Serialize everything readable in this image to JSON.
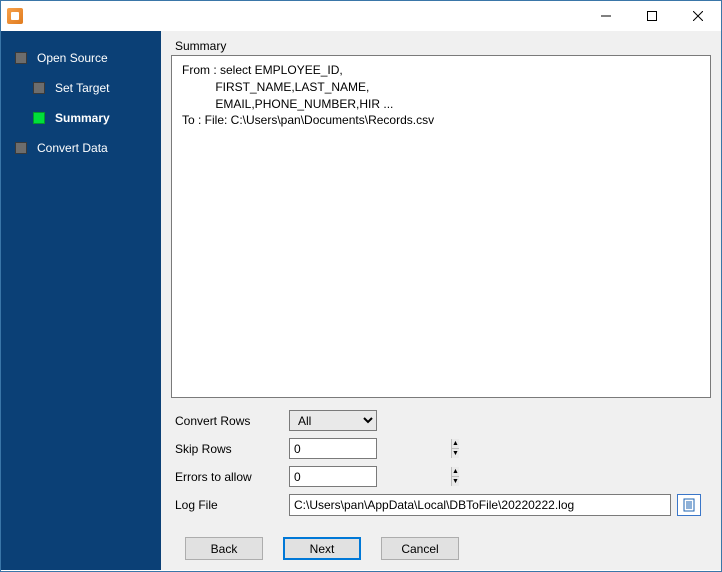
{
  "titlebar": {
    "title": ""
  },
  "sidebar": {
    "steps": [
      {
        "label": "Open Source",
        "active": false,
        "child": false
      },
      {
        "label": "Set Target",
        "active": false,
        "child": true
      },
      {
        "label": "Summary",
        "active": true,
        "child": true
      },
      {
        "label": "Convert Data",
        "active": false,
        "child": false
      }
    ]
  },
  "main": {
    "section_label": "Summary",
    "summary_text": "From : select EMPLOYEE_ID,\n          FIRST_NAME,LAST_NAME,\n          EMAIL,PHONE_NUMBER,HIR ...\nTo : File: C:\\Users\\pan\\Documents\\Records.csv"
  },
  "form": {
    "convert_rows": {
      "label": "Convert Rows",
      "value": "All",
      "options": [
        "All"
      ]
    },
    "skip_rows": {
      "label": "Skip Rows",
      "value": "0"
    },
    "errors_allow": {
      "label": "Errors to allow",
      "value": "0"
    },
    "log_file": {
      "label": "Log File",
      "value": "C:\\Users\\pan\\AppData\\Local\\DBToFile\\20220222.log"
    }
  },
  "buttons": {
    "back": "Back",
    "next": "Next",
    "cancel": "Cancel"
  }
}
